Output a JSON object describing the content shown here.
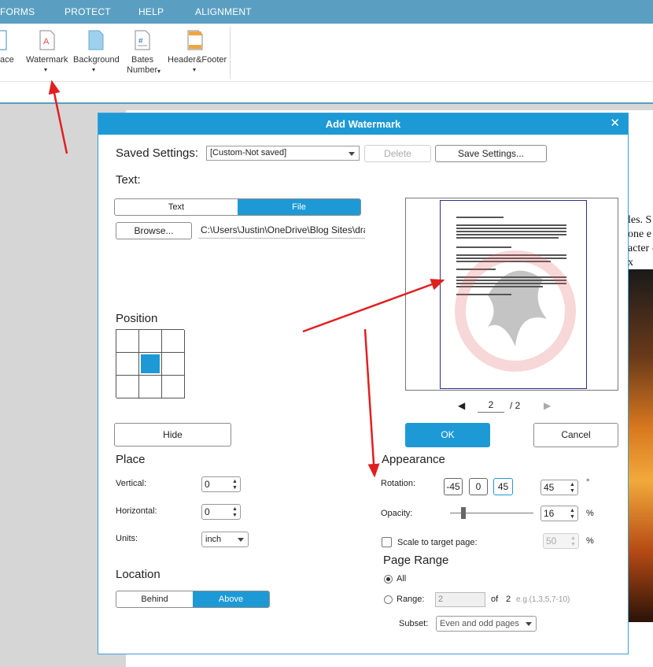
{
  "menu": {
    "items": [
      "FORMS",
      "PROTECT",
      "HELP",
      "ALIGNMENT"
    ]
  },
  "ribbon": {
    "partial_label": "ace",
    "watermark": "Watermark",
    "background": "Background",
    "bates_line1": "Bates",
    "bates_line2": "Number",
    "header_footer": "Header&Footer"
  },
  "document": {
    "line1": "les. S",
    "line2": "one e",
    "line3": "acter -",
    "line4": "x"
  },
  "dialog": {
    "title": "Add Watermark",
    "close": "✕",
    "saved_settings_label": "Saved Settings:",
    "saved_settings_value": "[Custom-Not saved]",
    "delete_label": "Delete",
    "save_settings_label": "Save Settings...",
    "text_section": "Text:",
    "tab_text": "Text",
    "tab_file": "File",
    "browse_label": "Browse...",
    "file_path": "C:\\Users\\Justin\\OneDrive\\Blog Sites\\dragon",
    "position_section": "Position",
    "hide_label": "Hide",
    "place_section": "Place",
    "vertical_label": "Vertical:",
    "vertical_value": "0",
    "horizontal_label": "Horizontal:",
    "horizontal_value": "0",
    "units_label": "Units:",
    "units_value": "inch",
    "location_section": "Location",
    "behind_label": "Behind",
    "above_label": "Above",
    "page_current": "2",
    "page_total": "/ 2",
    "ok_label": "OK",
    "cancel_label": "Cancel",
    "appearance_section": "Appearance",
    "rotation_label": "Rotation:",
    "rot_neg45": "-45",
    "rot_0": "0",
    "rot_45": "45",
    "rotation_value": "45",
    "rotation_unit": "°",
    "opacity_label": "Opacity:",
    "opacity_value": "16",
    "opacity_unit": "%",
    "opacity_fraction": 0.16,
    "scale_label": "Scale to target page:",
    "scale_value": "50",
    "scale_unit": "%",
    "page_range_section": "Page Range",
    "all_label": "All",
    "range_label": "Range:",
    "range_value": "2",
    "of_label": "of",
    "of_value": "2",
    "range_hint": "e.g.(1,3,5,7-10)",
    "subset_label": "Subset:",
    "subset_value": "Even and odd pages"
  },
  "colors": {
    "accent": "#1d9ad6",
    "menubar": "#5a9fc1",
    "annotation_arrow": "#e02020"
  }
}
